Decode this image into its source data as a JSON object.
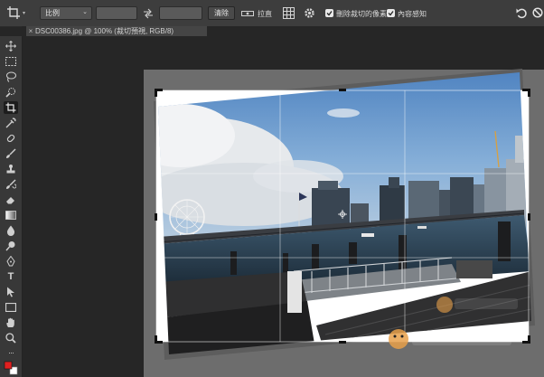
{
  "options_bar": {
    "crop_tool_icon": "crop-icon",
    "ratio_select": {
      "value": "比例"
    },
    "swap_icon": "swap-arrows-icon",
    "clear_label": "清除",
    "straighten_icon": "level-ruler-icon",
    "straighten_label": "拉直",
    "overlay_icon": "grid-overlay-icon",
    "settings_icon": "gear-icon",
    "delete_cropped_label": "刪除裁切的像素",
    "delete_cropped_checked": true,
    "content_aware_label": "內容感知",
    "content_aware_checked": true,
    "reset_icon": "undo-icon",
    "cancel_icon": "no-icon"
  },
  "document_tab": {
    "close_symbol": "×",
    "title": "DSC00386.jpg @ 100% (裁切預視, RGB/8)"
  },
  "toolbar": {
    "tools": [
      {
        "id": "move",
        "icon": "move-icon"
      },
      {
        "id": "marquee",
        "icon": "marquee-icon"
      },
      {
        "id": "lasso",
        "icon": "lasso-icon"
      },
      {
        "id": "quick-select",
        "icon": "quick-select-icon"
      },
      {
        "id": "crop",
        "icon": "crop-icon",
        "active": true
      },
      {
        "id": "eyedropper",
        "icon": "eyedropper-icon"
      },
      {
        "id": "healing",
        "icon": "healing-brush-icon"
      },
      {
        "id": "brush",
        "icon": "brush-icon"
      },
      {
        "id": "stamp",
        "icon": "clone-stamp-icon"
      },
      {
        "id": "history-brush",
        "icon": "history-brush-icon"
      },
      {
        "id": "eraser",
        "icon": "eraser-icon"
      },
      {
        "id": "gradient",
        "icon": "gradient-icon"
      },
      {
        "id": "blur",
        "icon": "blur-drop-icon"
      },
      {
        "id": "dodge",
        "icon": "dodge-icon"
      },
      {
        "id": "pen",
        "icon": "pen-icon"
      },
      {
        "id": "type",
        "icon": "type-icon",
        "glyph": "T"
      },
      {
        "id": "path-select",
        "icon": "path-select-icon"
      },
      {
        "id": "shape",
        "icon": "rectangle-shape-icon"
      },
      {
        "id": "hand",
        "icon": "hand-icon"
      },
      {
        "id": "zoom",
        "icon": "zoom-icon"
      },
      {
        "id": "more",
        "icon": "more-icon",
        "glyph": "···"
      },
      {
        "id": "colors",
        "icon": "color-swatches-icon"
      }
    ]
  },
  "photo": {
    "description_icon": "harbor-photo",
    "watermark_icon": "mascot-watermark-icon",
    "colors": {
      "sky_top": "#4f86c4",
      "sky_mid": "#8fb6da",
      "cloud": "#e9ecef",
      "water": "#1f3546",
      "bridge": "#3a3d42",
      "deck": "#2b2b2b",
      "city": "#3f4a55"
    }
  }
}
